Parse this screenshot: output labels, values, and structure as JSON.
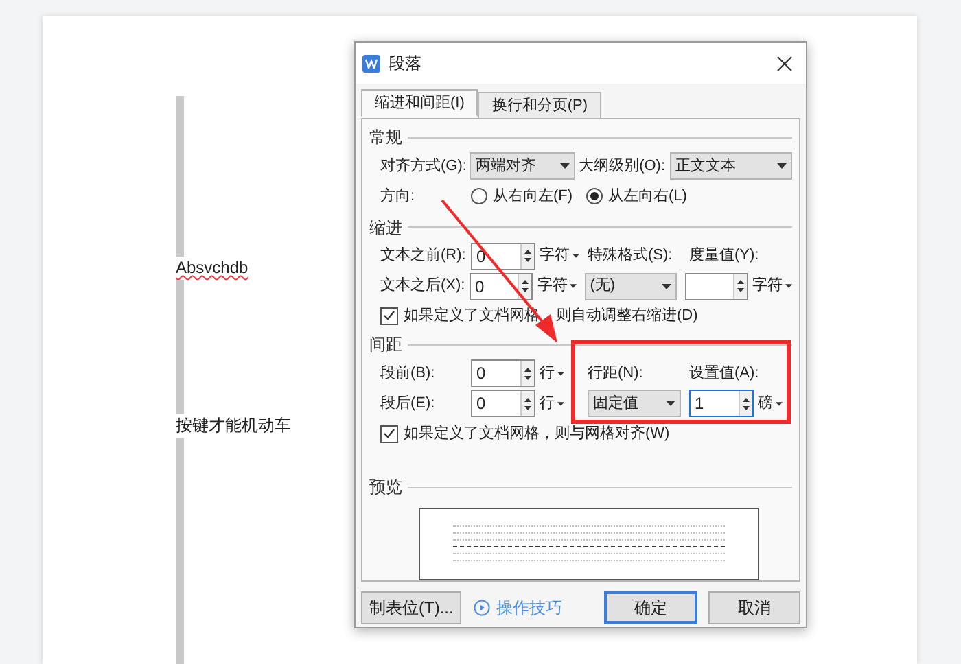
{
  "document": {
    "lines": [
      {
        "text": "Absvchdb",
        "misspelled": true
      },
      {
        "text": "按键才能机动车",
        "misspelled": false
      }
    ]
  },
  "dialog": {
    "title": "段落",
    "tabs": [
      {
        "label": "缩进和间距(I)",
        "selected": true
      },
      {
        "label": "换行和分页(P)",
        "selected": false
      }
    ],
    "general": {
      "heading": "常规",
      "alignment": {
        "label": "对齐方式(G):",
        "value": "两端对齐"
      },
      "outline": {
        "label": "大纲级别(O):",
        "value": "正文文本"
      },
      "direction": {
        "label": "方向:",
        "options": [
          {
            "label": "从右向左(F)",
            "selected": false
          },
          {
            "label": "从左向右(L)",
            "selected": true
          }
        ]
      }
    },
    "indent": {
      "heading": "缩进",
      "before": {
        "label": "文本之前(R):",
        "value": "0",
        "unit": "字符"
      },
      "after": {
        "label": "文本之后(X):",
        "value": "0",
        "unit": "字符"
      },
      "special": {
        "label": "特殊格式(S):",
        "value": "(无)"
      },
      "measure": {
        "label": "度量值(Y):",
        "unit": "字符"
      },
      "checkbox": {
        "label_parts": [
          "如果定义了文档网格",
          "则自动调整右缩进(D)"
        ],
        "checked": true
      }
    },
    "spacing": {
      "heading": "间距",
      "before": {
        "label": "段前(B):",
        "value": "0",
        "unit": "行"
      },
      "after": {
        "label": "段后(E):",
        "value": "0",
        "unit": "行"
      },
      "line_spacing": {
        "label": "行距(N):",
        "value": "固定值"
      },
      "setting": {
        "label": "设置值(A):",
        "value": "1",
        "unit": "磅",
        "focused": true
      },
      "checkbox": {
        "label": "如果定义了文档网格，则与网格对齐(W)",
        "checked": true
      }
    },
    "preview": {
      "heading": "预览"
    },
    "footer": {
      "tabs_button": "制表位(T)...",
      "tips_link": "操作技巧",
      "ok": "确定",
      "cancel": "取消"
    }
  }
}
